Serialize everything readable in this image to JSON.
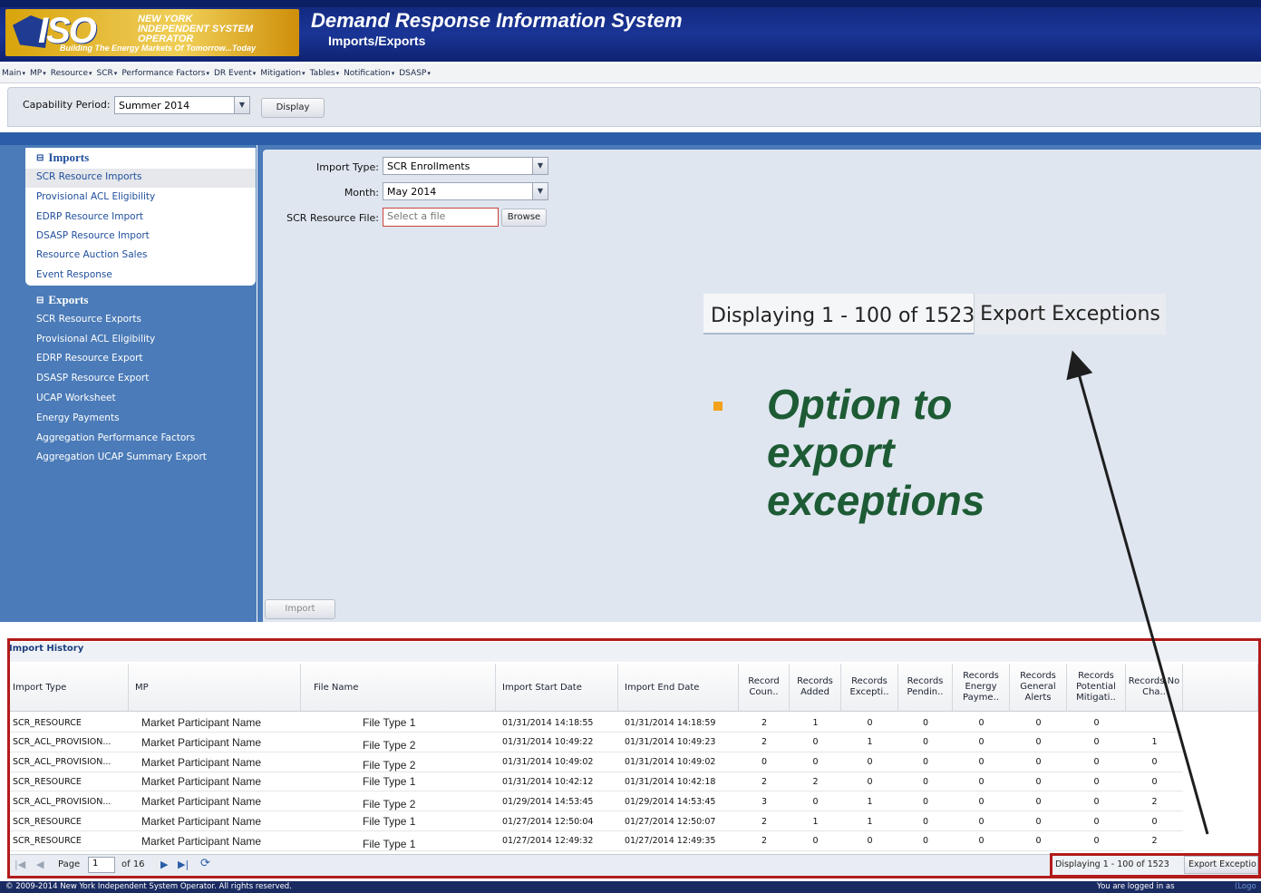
{
  "header": {
    "logo_iso": "ISO",
    "logo_org": "NEW YORK INDEPENDENT SYSTEM OPERATOR",
    "logo_tagline": "Building The Energy Markets Of Tomorrow...Today",
    "app_title": "Demand Response Information System",
    "page_subtitle": "Imports/Exports"
  },
  "menu": [
    "Main",
    "MP",
    "Resource",
    "SCR",
    "Performance Factors",
    "DR Event",
    "Mitigation",
    "Tables",
    "Notification",
    "DSASP"
  ],
  "capability": {
    "label": "Capability Period:",
    "value": "Summer 2014",
    "display_button": "Display"
  },
  "nav": {
    "imports_heading": "Imports",
    "imports": [
      "SCR Resource Imports",
      "Provisional ACL Eligibility",
      "EDRP Resource Import",
      "DSASP Resource Import",
      "Resource Auction Sales",
      "Event Response"
    ],
    "exports_heading": "Exports",
    "exports": [
      "SCR Resource Exports",
      "Provisional ACL Eligibility",
      "EDRP Resource Export",
      "DSASP Resource Export",
      "UCAP Worksheet",
      "Energy Payments",
      "Aggregation Performance Factors",
      "Aggregation UCAP Summary Export"
    ]
  },
  "form": {
    "import_type_label": "Import Type:",
    "import_type_value": "SCR Enrollments",
    "month_label": "Month:",
    "month_value": "May 2014",
    "file_label": "SCR Resource File:",
    "file_placeholder": "Select a file",
    "browse_button": "Browse",
    "import_button": "Import"
  },
  "callout": {
    "zoom_display": "Displaying 1 - 100 of 1523",
    "zoom_button": "Export Exceptions",
    "text": "Option to export exceptions"
  },
  "history": {
    "title": "Import History",
    "columns": [
      "Import Type",
      "MP",
      "File Name",
      "Import Start Date",
      "Import End Date",
      "Record Coun..",
      "Records Added",
      "Records Excepti..",
      "Records Pendin..",
      "Records Energy Payme..",
      "Records General Alerts",
      "Records Potential Mitigati..",
      "Records No Cha.."
    ],
    "rows": [
      [
        "SCR_RESOURCE",
        "Market Participant Name",
        "File Type 1",
        "01/31/2014 14:18:55",
        "01/31/2014 14:18:59",
        "2",
        "1",
        "0",
        "0",
        "0",
        "0",
        "0",
        ""
      ],
      [
        "SCR_ACL_PROVISION...",
        "Market Participant Name",
        "File Type 2",
        "01/31/2014 10:49:22",
        "01/31/2014 10:49:23",
        "2",
        "0",
        "1",
        "0",
        "0",
        "0",
        "0",
        "1"
      ],
      [
        "SCR_ACL_PROVISION...",
        "Market Participant Name",
        "File Type 2",
        "01/31/2014 10:49:02",
        "01/31/2014 10:49:02",
        "0",
        "0",
        "0",
        "0",
        "0",
        "0",
        "0",
        "0"
      ],
      [
        "SCR_RESOURCE",
        "Market Participant Name",
        "File Type 1",
        "01/31/2014 10:42:12",
        "01/31/2014 10:42:18",
        "2",
        "2",
        "0",
        "0",
        "0",
        "0",
        "0",
        "0"
      ],
      [
        "SCR_ACL_PROVISION...",
        "Market Participant Name",
        "File Type 2",
        "01/29/2014 14:53:45",
        "01/29/2014 14:53:45",
        "3",
        "0",
        "1",
        "0",
        "0",
        "0",
        "0",
        "2"
      ],
      [
        "SCR_RESOURCE",
        "Market Participant Name",
        "File Type 1",
        "01/27/2014 12:50:04",
        "01/27/2014 12:50:07",
        "2",
        "1",
        "1",
        "0",
        "0",
        "0",
        "0",
        "0"
      ],
      [
        "SCR_RESOURCE",
        "Market Participant Name",
        "File Type 1",
        "01/27/2014 12:49:32",
        "01/27/2014 12:49:35",
        "2",
        "0",
        "0",
        "0",
        "0",
        "0",
        "0",
        "2"
      ]
    ]
  },
  "pager": {
    "page_label": "Page",
    "page_value": "1",
    "of_label": "of 16",
    "display_text": "Displaying 1 - 100 of 1523",
    "export_button": "Export Exceptio"
  },
  "footer": {
    "copyright": "© 2009-2014 New York Independent System Operator. All rights reserved.",
    "logged_in": "You are logged in as",
    "logout": "(Logo"
  },
  "colors": {
    "banner": "#1a3596",
    "nav_panel": "#4b7bb8",
    "highlight_border": "#b21b1b",
    "callout_text": "#1d5b34",
    "bullet": "#f2a21b"
  }
}
